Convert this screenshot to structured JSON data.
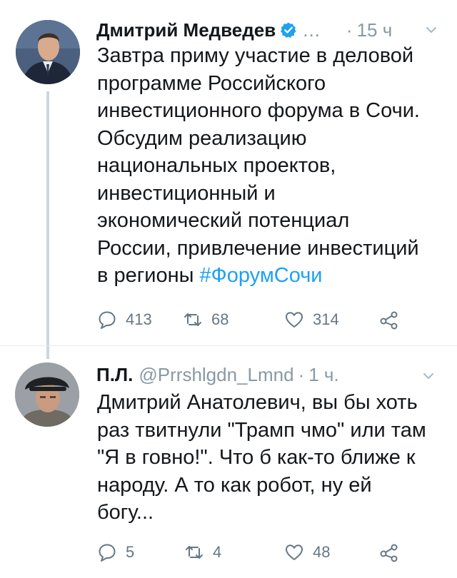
{
  "tweets": [
    {
      "author": "Дмитрий Медведев",
      "ellipsis": "...",
      "separator": "·",
      "time": "15 ч",
      "text_lines": [
        "Завтра приму участие в деловой",
        "программе Российского",
        "инвестиционного форума в Сочи.",
        "Обсудим реализацию",
        "национальных проектов,",
        "инвестиционный и",
        "экономический потенциал",
        "России, привлечение инвестиций"
      ],
      "last_line_text": "в регионы ",
      "hashtag": "#ФорумСочи",
      "replies": "413",
      "retweets": "68",
      "likes": "314"
    },
    {
      "author": "П.Л.",
      "handle": "@Prrshlgdn_Lmnd",
      "separator": "·",
      "time": "1 ч.",
      "text_lines": [
        "Дмитрий Анатолевич, вы бы хоть",
        "раз твитнули \"Трамп чмо\" или там",
        "\"Я в говно!\". Что б как-то ближе к",
        "народу. А то как робот, ну ей",
        "богу..."
      ],
      "replies": "5",
      "retweets": "4",
      "likes": "48"
    }
  ],
  "icons": [
    "verified-badge-icon",
    "chevron-down-icon",
    "reply-icon",
    "retweet-icon",
    "like-icon",
    "share-icon"
  ],
  "colors": {
    "link": "#1da1f2",
    "muted": "#8899a6",
    "text": "#14171a",
    "verified": "#1da1f2"
  }
}
